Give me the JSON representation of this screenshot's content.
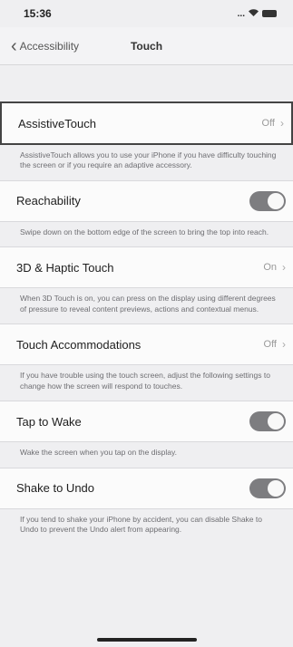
{
  "status": {
    "time": "15:36",
    "signal": "..."
  },
  "nav": {
    "back_label": "Accessibility",
    "title": "Touch"
  },
  "colors": {
    "toggle_on": "#7d7d80",
    "background": "#efeff1"
  },
  "sections": {
    "assistive": {
      "label": "AssistiveTouch",
      "value": "Off",
      "footer": "AssistiveTouch allows you to use your iPhone if you have difficulty touching the screen or if you require an adaptive accessory."
    },
    "reachability": {
      "label": "Reachability",
      "toggle": "on",
      "footer": "Swipe down on the bottom edge of the screen to bring the top into reach."
    },
    "haptic": {
      "label": "3D & Haptic Touch",
      "value": "On",
      "footer": "When 3D Touch is on, you can press on the display using different degrees of pressure to reveal content previews, actions and contextual menus."
    },
    "accommodations": {
      "label": "Touch Accommodations",
      "value": "Off",
      "footer": "If you have trouble using the touch screen, adjust the following settings to change how the screen will respond to touches."
    },
    "tap_to_wake": {
      "label": "Tap to Wake",
      "toggle": "on",
      "footer": "Wake the screen when you tap on the display."
    },
    "shake_to_undo": {
      "label": "Shake to Undo",
      "toggle": "on",
      "footer": "If you tend to shake your iPhone by accident, you can disable Shake to Undo to prevent the Undo alert from appearing."
    }
  }
}
